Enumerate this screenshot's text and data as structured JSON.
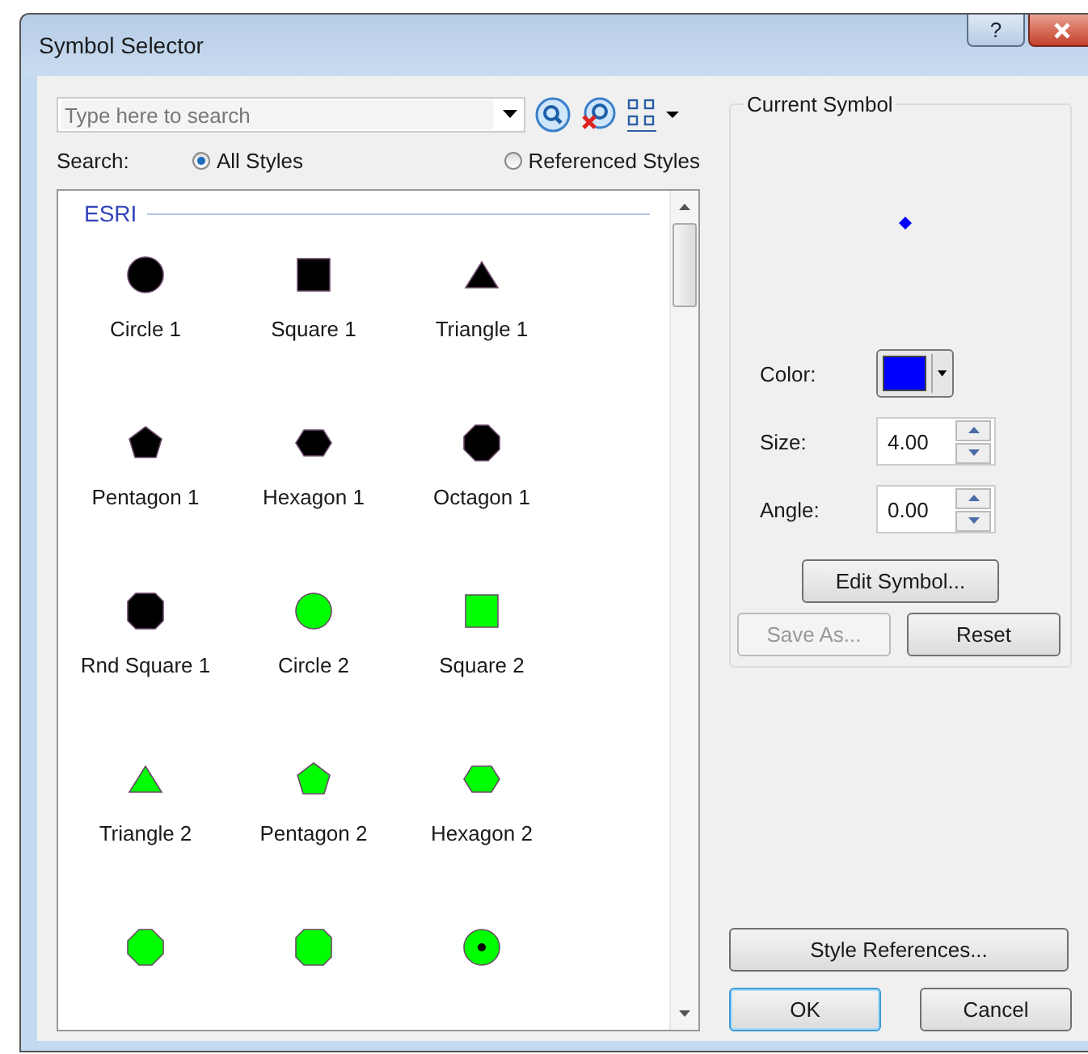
{
  "window": {
    "title": "Symbol Selector",
    "help_button": "?"
  },
  "search": {
    "placeholder": "Type here to search"
  },
  "search_scope": {
    "label": "Search:",
    "options": [
      {
        "label": "All Styles",
        "selected": true
      },
      {
        "label": "Referenced Styles",
        "selected": false
      }
    ]
  },
  "gallery": {
    "group": "ESRI",
    "symbols": [
      {
        "kind": "circle",
        "color": "#000000",
        "label": "Circle 1"
      },
      {
        "kind": "square",
        "color": "#000000",
        "label": "Square 1"
      },
      {
        "kind": "triangle",
        "color": "#000000",
        "label": "Triangle 1"
      },
      {
        "kind": "pentagon",
        "color": "#000000",
        "label": "Pentagon 1"
      },
      {
        "kind": "hexagon",
        "color": "#000000",
        "label": "Hexagon 1"
      },
      {
        "kind": "octagon",
        "color": "#000000",
        "label": "Octagon 1"
      },
      {
        "kind": "rounded-square",
        "color": "#000000",
        "label": "Rnd Square 1"
      },
      {
        "kind": "circle",
        "color": "#00ff00",
        "label": "Circle 2"
      },
      {
        "kind": "square",
        "color": "#00ff00",
        "label": "Square 2"
      },
      {
        "kind": "triangle",
        "color": "#00ff00",
        "label": "Triangle 2"
      },
      {
        "kind": "pentagon",
        "color": "#00ff00",
        "label": "Pentagon 2"
      },
      {
        "kind": "hexagon",
        "color": "#00ff00",
        "label": "Hexagon 2"
      },
      {
        "kind": "octagon",
        "color": "#00ff00"
      },
      {
        "kind": "rounded-square",
        "color": "#00ff00"
      },
      {
        "kind": "circle-dot",
        "color": "#00ff00"
      }
    ]
  },
  "current_symbol": {
    "title": "Current Symbol",
    "color_label": "Color:",
    "color": "#0000ff",
    "size_label": "Size:",
    "size": "4.00",
    "angle_label": "Angle:",
    "angle": "0.00"
  },
  "symbol_buttons": [
    {
      "label": "Edit Symbol...",
      "disabled": false
    },
    {
      "label": "Save As...",
      "disabled": true
    },
    {
      "label": "Reset",
      "disabled": false
    }
  ],
  "footer_buttons": [
    {
      "label": "Style References...",
      "default": false
    },
    {
      "label": "OK",
      "default": true
    },
    {
      "label": "Cancel",
      "default": false
    }
  ]
}
